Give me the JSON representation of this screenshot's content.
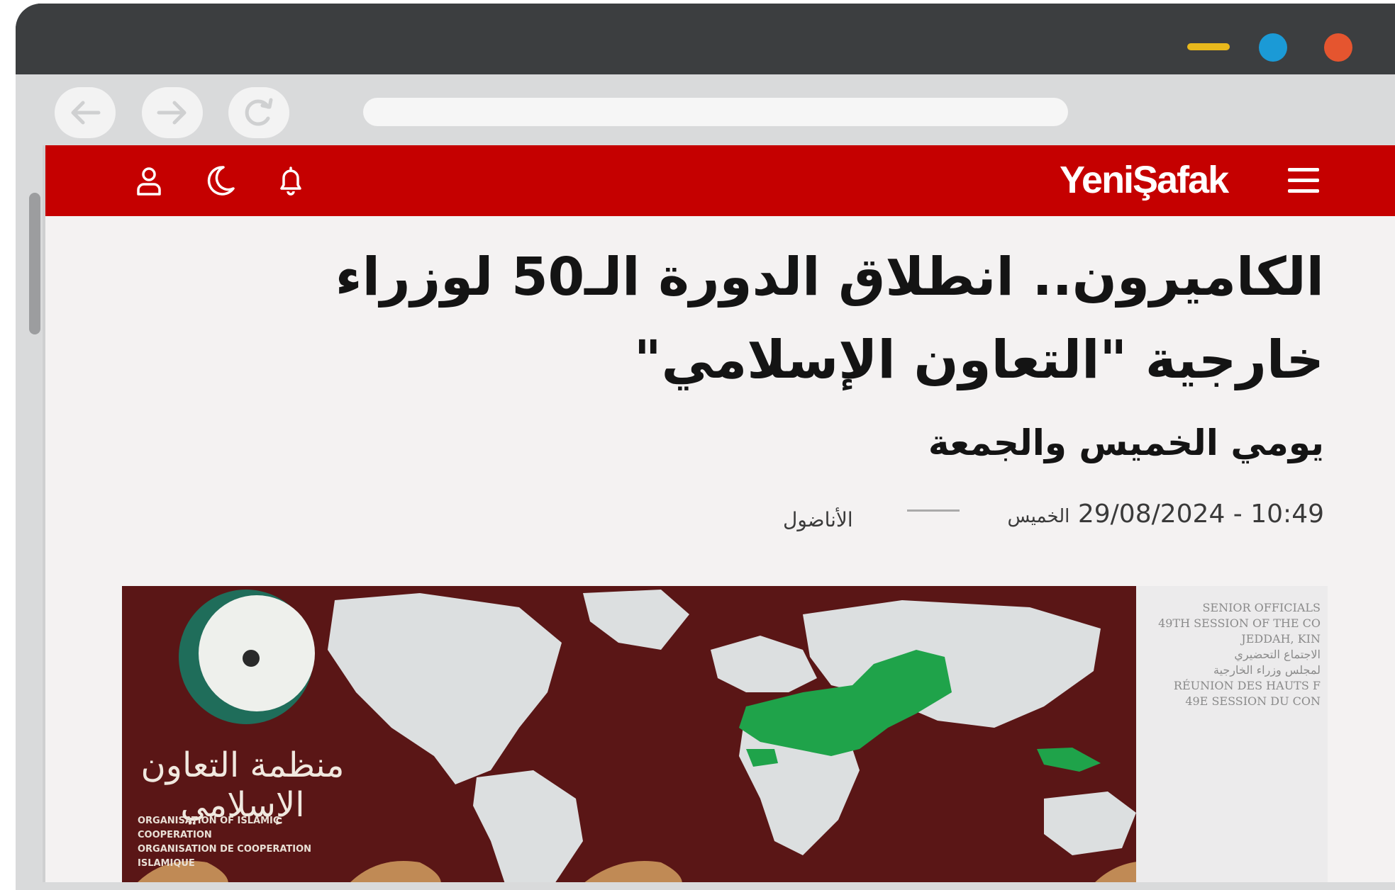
{
  "site": {
    "logo": "YeniŞafak"
  },
  "article": {
    "headline": "الكاميرون.. انطلاق الدورة الـ50 لوزراء خارجية \"التعاون الإسلامي\"",
    "subheadline": "يومي الخميس والجمعة",
    "time": "10:49 - 29/08/2024",
    "day": "الخميس",
    "source": "الأناضول"
  },
  "image": {
    "org_arabic": "منظمة التعاون الإسلامي",
    "org_en": "ORGANISATION OF ISLAMIC COOPERATION",
    "org_fr": "ORGANISATION DE COOPERATION ISLAMIQUE",
    "banner_lines": [
      "SENIOR OFFICIALS",
      "49TH SESSION OF THE CO",
      "JEDDAH, KIN",
      "الاجتماع التحضيري",
      "لمجلس وزراء الخارجية",
      "RÉUNION DES HAUTS F",
      "49E SESSION DU CON"
    ]
  },
  "colors": {
    "brand_red": "#c50000",
    "map_green": "#1fa34a",
    "map_background": "#5a1616"
  },
  "icons": {
    "back": "arrow-left-icon",
    "forward": "arrow-right-icon",
    "reload": "reload-icon",
    "user": "user-icon",
    "moon": "moon-icon",
    "bell": "bell-icon",
    "menu": "hamburger-menu-icon"
  }
}
